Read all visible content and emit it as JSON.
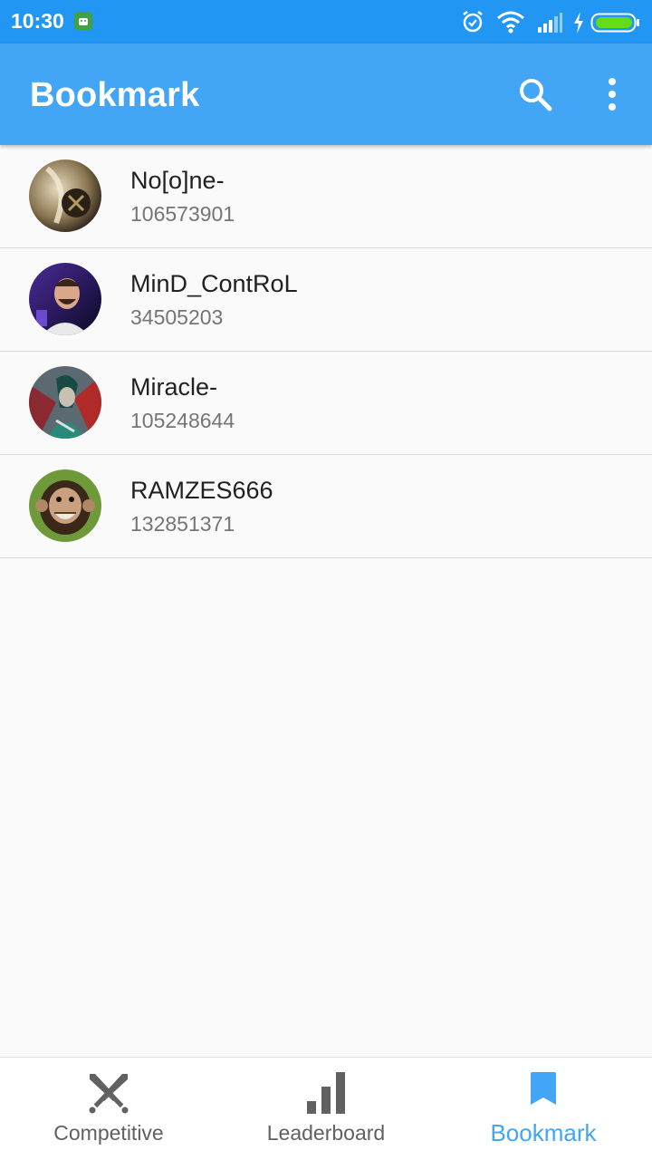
{
  "status_bar": {
    "time": "10:30",
    "icons": [
      "android-icon",
      "alarm-icon",
      "wifi-icon",
      "signal-icon",
      "charging-icon",
      "battery-icon"
    ]
  },
  "app_bar": {
    "title": "Bookmark",
    "actions": [
      "search-icon",
      "more-vert-icon"
    ]
  },
  "bookmarks": [
    {
      "name": "No[o]ne-",
      "id": "106573901"
    },
    {
      "name": "MinD_ContRoL",
      "id": "34505203"
    },
    {
      "name": "Miracle-",
      "id": "105248644"
    },
    {
      "name": "RAMZES666",
      "id": "132851371"
    }
  ],
  "bottom_nav": {
    "items": [
      {
        "label": "Competitive",
        "icon": "crossed-swords-icon"
      },
      {
        "label": "Leaderboard",
        "icon": "bar-chart-icon"
      },
      {
        "label": "Bookmark",
        "icon": "bookmark-icon"
      }
    ],
    "active": "Bookmark"
  },
  "colors": {
    "status_bar": "#2196f3",
    "app_bar": "#42a5f5",
    "accent": "#42a5f5",
    "inactive_nav": "#616161"
  }
}
